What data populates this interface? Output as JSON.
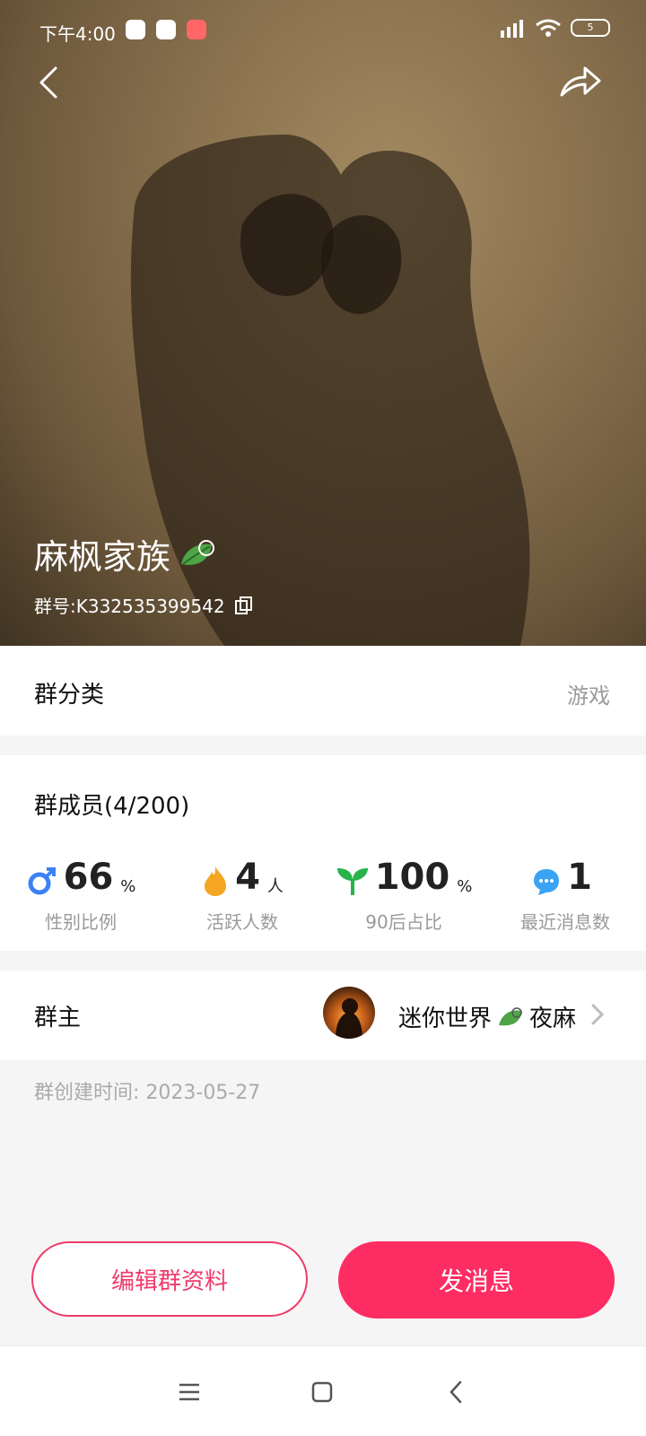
{
  "status_bar": {
    "time": "下午4:00",
    "battery": "5"
  },
  "header": {
    "group_name": "麻枫家族",
    "group_id": "群号:K332535399542"
  },
  "category": {
    "label": "群分类",
    "value": "游戏"
  },
  "members": {
    "title": "群成员(4/200)",
    "stats": [
      {
        "icon": "male-icon",
        "value": "66",
        "unit": "%",
        "label": "性别比例",
        "color": "#3b82f6"
      },
      {
        "icon": "fire-icon",
        "value": "4",
        "unit": "人",
        "label": "活跃人数",
        "color": "#f5a623"
      },
      {
        "icon": "sprout-icon",
        "value": "100",
        "unit": "%",
        "label": "90后占比",
        "color": "#28b34a"
      },
      {
        "icon": "chat-bubble-icon",
        "value": "1",
        "unit": "",
        "label": "最近消息数",
        "color": "#3aa3f2"
      }
    ]
  },
  "owner": {
    "label": "群主",
    "name_part1": "迷你世界",
    "name_part2": "夜麻"
  },
  "created": "群创建时间: 2023-05-27",
  "actions": {
    "edit_label": "编辑群资料",
    "send_label": "发消息"
  },
  "colors": {
    "accent": "#fd2d63",
    "muted": "#9b9b9b"
  }
}
